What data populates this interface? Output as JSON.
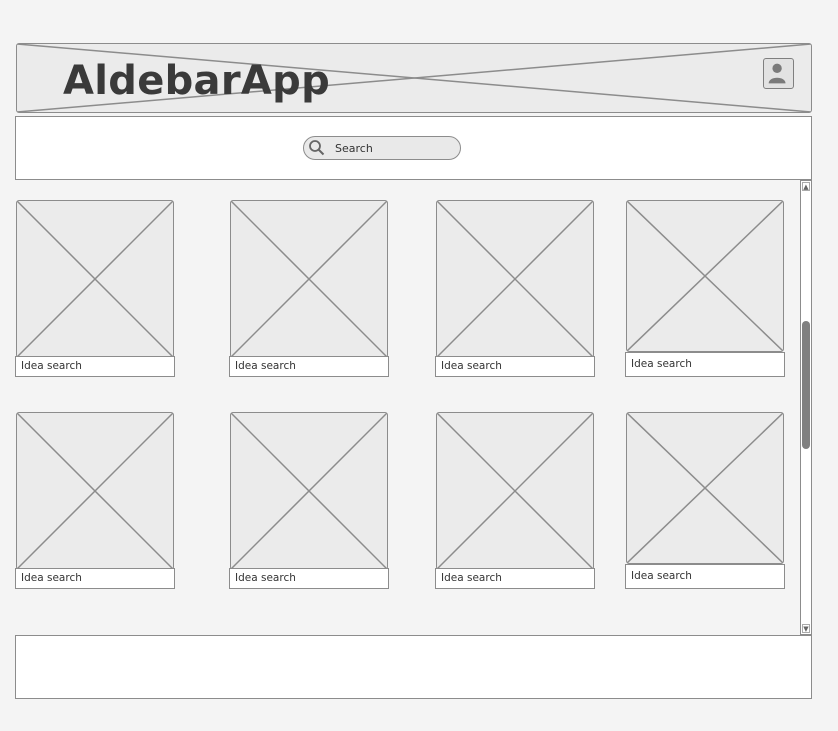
{
  "header": {
    "app_title": "AldebarApp",
    "avatar_icon": "user-avatar-icon"
  },
  "navbar": {
    "search_placeholder": "Search",
    "search_icon": "search-icon"
  },
  "cards": [
    {
      "caption": "Idea search"
    },
    {
      "caption": "Idea search"
    },
    {
      "caption": "Idea search"
    },
    {
      "caption": "Idea search"
    },
    {
      "caption": "Idea search"
    },
    {
      "caption": "Idea search"
    },
    {
      "caption": "Idea search"
    },
    {
      "caption": "Idea search"
    }
  ],
  "scrollbar": {
    "up_arrow": "▲",
    "down_arrow": "▼"
  },
  "colors": {
    "background": "#f4f4f4",
    "placeholder": "#ebebeb",
    "border": "#8c8c8c",
    "thumb": "#808080"
  }
}
